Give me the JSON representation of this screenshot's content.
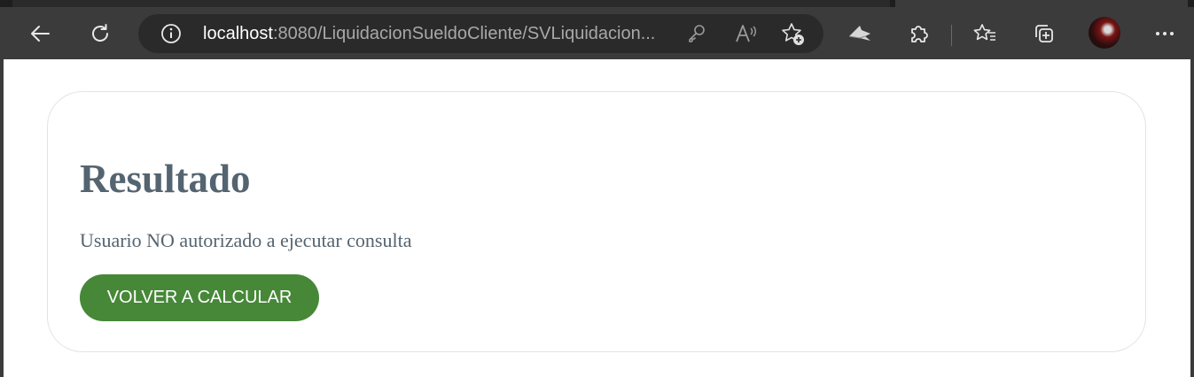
{
  "browser": {
    "url_host": "localhost",
    "url_rest": ":8080/LiquidacionSueldoCliente/SVLiquidacion..."
  },
  "page": {
    "title": "Resultado",
    "message": "Usuario NO autorizado a ejecutar consulta",
    "button_label": "VOLVER A CALCULAR"
  },
  "colors": {
    "toolbar": "#3b3b3b",
    "text": "#546470",
    "button": "#468838"
  }
}
